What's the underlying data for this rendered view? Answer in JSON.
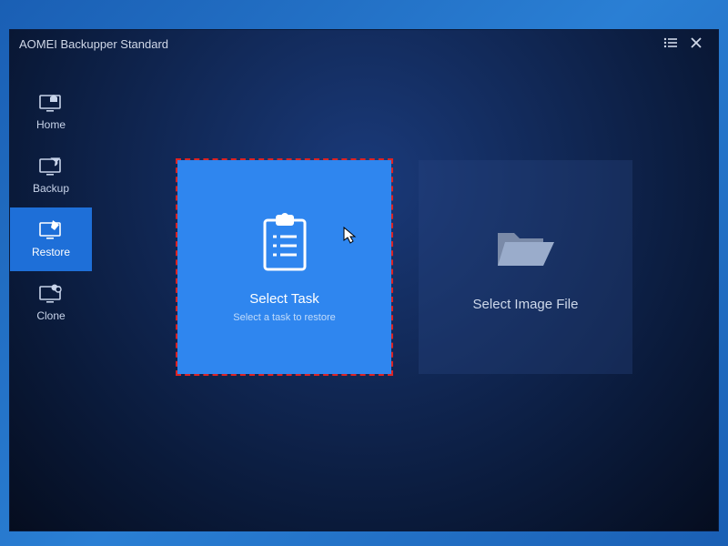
{
  "titlebar": {
    "title": "AOMEI Backupper Standard",
    "menu_icon": "menu",
    "close_icon": "close"
  },
  "sidebar": {
    "items": [
      {
        "label": "Home",
        "icon": "monitor-home",
        "active": false
      },
      {
        "label": "Backup",
        "icon": "monitor-arrow",
        "active": false
      },
      {
        "label": "Restore",
        "icon": "monitor-pencil",
        "active": true
      },
      {
        "label": "Clone",
        "icon": "monitor-disks",
        "active": false
      }
    ]
  },
  "main": {
    "select_task": {
      "title": "Select Task",
      "sub": "Select a task to restore",
      "icon": "clipboard-list"
    },
    "select_image": {
      "title": "Select Image File",
      "icon": "folder-open"
    }
  }
}
